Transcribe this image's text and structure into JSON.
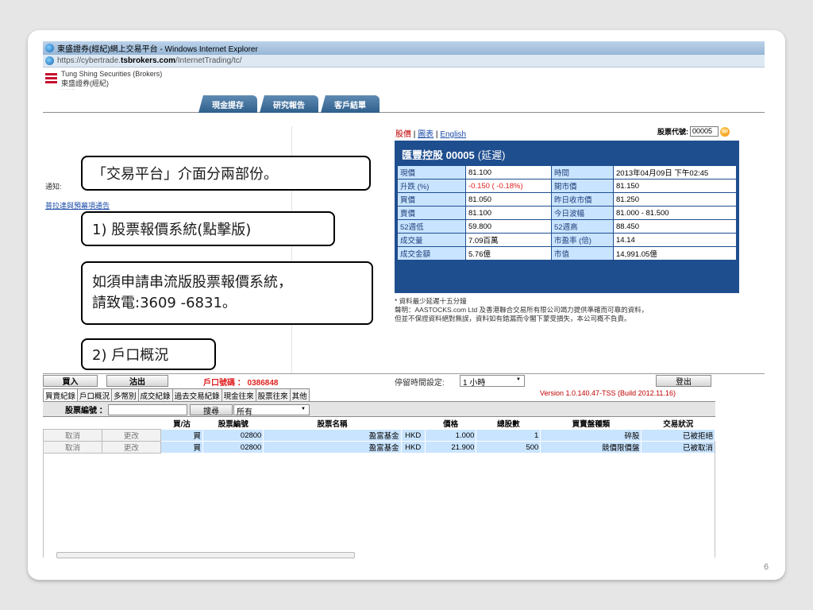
{
  "window": {
    "title": "東盛證券(經紀)網上交易平台 - Windows Internet Explorer",
    "url_prefix": "https://cybertrade.",
    "url_domain": "tsbrokers.com",
    "url_path": "/InternetTrading/tc/"
  },
  "logo": {
    "en": "Tung Shing Securities (Brokers)",
    "zh": "東盛證券(經紀)"
  },
  "nav": [
    "現金提存",
    "研究報告",
    "客戶結單"
  ],
  "left": {
    "notice_label": "通知:",
    "notice_link": "普拉達與預幕項通告"
  },
  "quote_links": {
    "price": "股價",
    "chart": "圖表",
    "english": "English"
  },
  "stock_code": {
    "label": "股票代號:",
    "value": "00005",
    "go": "GO"
  },
  "quote": {
    "name": "匯豐控股 00005",
    "delay": "(延遲)",
    "rows": [
      [
        "現價",
        "81.100",
        "時間",
        "2013年04月09日 下午02:45"
      ],
      [
        "升跌 (%)",
        "-0.150 ( -0.18%)",
        "開市價",
        "81.150"
      ],
      [
        "買價",
        "81.050",
        "昨日收市價",
        "81.250"
      ],
      [
        "賣價",
        "81.100",
        "今日波幅",
        "81.000 - 81.500"
      ],
      [
        "52週低",
        "59.800",
        "52週高",
        "88.450"
      ],
      [
        "成交量",
        "7.09百萬",
        "市盈率 (倍)",
        "14.14"
      ],
      [
        "成交金額",
        "5.76億",
        "市值",
        "14,991.05億"
      ]
    ]
  },
  "disclaimer": {
    "line1": "* 資料最少延遲十五分鐘",
    "line2": "聲明：AASTOCKS.com Ltd 及香港聯合交易所有限公司竭力提供準確而可靠的資料，",
    "line3": "但並不保證資料絕對無誤，資料如有錯漏而令閣下蒙受損失，本公司概不負責。"
  },
  "callouts": {
    "c1": "「交易平台」介面分兩部份。",
    "c2": "1) 股票報價系統(點擊版)",
    "c3_line1": "如須申請串流版股票報價系統，",
    "c3_line2": "請致電:3609 -6831。",
    "c4": "2) 戶口概況"
  },
  "trade": {
    "buy": "買入",
    "sell": "沽出",
    "account_label": "戶口號碼 ： 0386848",
    "idle_label": "停留時間設定:",
    "idle_value": "1 小時",
    "logout": "登出",
    "version": "Version 1.0.140.47-TSS (Build 2012.11.16)"
  },
  "tabs": [
    "買賣紀錄",
    "戶口概況",
    "多幣別",
    "成交紀錄",
    "過去交易紀錄",
    "現金往來",
    "股票往來",
    "其他"
  ],
  "search": {
    "label": "股票編號 ：",
    "button": "搜尋",
    "select": "所有"
  },
  "orders": {
    "headers": [
      "",
      "",
      "買/沽",
      "股票編號",
      "股票名稱",
      "",
      "價格",
      "總股數",
      "買賣盤種類",
      "交易狀況"
    ],
    "rows": [
      [
        "取消",
        "更改",
        "買",
        "02800",
        "盈富基金",
        "HKD",
        "1.000",
        "1",
        "碎股",
        "已被拒絕"
      ],
      [
        "取消",
        "更改",
        "買",
        "02800",
        "盈富基金",
        "HKD",
        "21.900",
        "500",
        "競價限價盤",
        "已被取消"
      ]
    ]
  },
  "page_number": "6",
  "colors": {
    "quote_header": "#1f4e8f",
    "label_cell": "#c9e4ff",
    "negative": "#e02020",
    "brand_red": "#c8102e"
  }
}
